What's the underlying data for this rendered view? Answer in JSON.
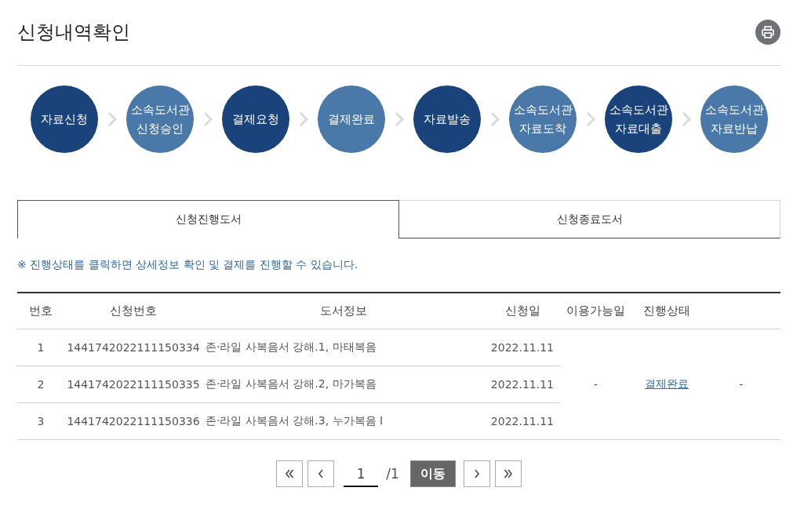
{
  "page": {
    "title": "신청내역확인"
  },
  "steps": [
    {
      "lines": [
        "자료신청"
      ],
      "color": "#1a437c"
    },
    {
      "lines": [
        "소속도서관",
        "신청승인"
      ],
      "color": "#4a78a8"
    },
    {
      "lines": [
        "결제요청"
      ],
      "color": "#1a437c"
    },
    {
      "lines": [
        "결제완료"
      ],
      "color": "#4a78a8"
    },
    {
      "lines": [
        "자료발송"
      ],
      "color": "#1a437c"
    },
    {
      "lines": [
        "소속도서관",
        "자료도착"
      ],
      "color": "#4a78a8"
    },
    {
      "lines": [
        "소속도서관",
        "자료대출"
      ],
      "color": "#1a437c"
    },
    {
      "lines": [
        "소속도서관",
        "자료반납"
      ],
      "color": "#4a78a8"
    }
  ],
  "tabs": [
    {
      "label": "신청진행도서",
      "selected": true
    },
    {
      "label": "신청종료도서",
      "selected": false
    }
  ],
  "notice": "※ 진행상태를 클릭하면 상세정보 확인 및 결제를 진행할 수 있습니다.",
  "table": {
    "columns": [
      "번호",
      "신청번호",
      "도서정보",
      "신청일",
      "이용가능일",
      "진행상태"
    ],
    "rows": [
      {
        "no": "1",
        "request_no": "1441742022111150334",
        "book_info": "존·라일 사복음서 강해.1, 마태복음",
        "date": "2022.11.11"
      },
      {
        "no": "2",
        "request_no": "1441742022111150335",
        "book_info": "존·라일 사복음서 강해.2, 마가복음",
        "date": "2022.11.11"
      },
      {
        "no": "3",
        "request_no": "1441742022111150336",
        "book_info": "존·라일 사복음서 강해.3, 누가복음 I",
        "date": "2022.11.11"
      }
    ],
    "merged": {
      "available_date": "-",
      "status": "결제완료",
      "column_7": "-"
    }
  },
  "pagination": {
    "page": "1",
    "total": "/1",
    "go": "이동"
  }
}
